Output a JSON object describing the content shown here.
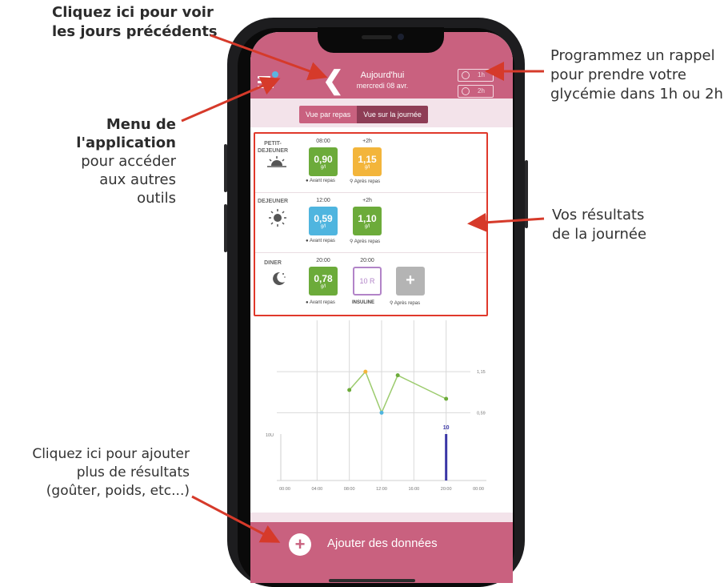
{
  "annotations": {
    "previous_days": [
      "Cliquez ici pour voir",
      "les jours précédents"
    ],
    "menu_bold": [
      "Menu de",
      "l'application"
    ],
    "menu_rest": [
      "pour accéder",
      "aux autres",
      "outils"
    ],
    "reminder": [
      "Programmez un rappel",
      "pour prendre votre",
      "glycémie dans 1h ou 2h"
    ],
    "results": [
      "Vos résultats",
      "de la journée"
    ],
    "add_more": [
      "Cliquez ici pour ajouter",
      "plus de résultats",
      "(goûter, poids, etc...)"
    ]
  },
  "header": {
    "title": "Aujourd'hui",
    "date": "mercredi 08 avr.",
    "back_symbol": "❮",
    "alarm_1h": "1h",
    "alarm_2h": "2h"
  },
  "tabs": {
    "by_meal": "Vue par repas",
    "by_day": "Vue sur la journée"
  },
  "meals": {
    "breakfast": {
      "name_1": "PETIT-",
      "name_2": "DEJEUNER",
      "icon": "sunrise-icon",
      "before_time": "08:00",
      "before_value": "0,90",
      "before_unit": "g/l",
      "before_caption": "Avant repas",
      "after_time": "+2h",
      "after_value": "1,15",
      "after_unit": "g/l",
      "after_caption": "Après repas"
    },
    "lunch": {
      "name_1": "DEJEUNER",
      "icon": "sun-icon",
      "before_time": "12:00",
      "before_value": "0,59",
      "before_unit": "g/l",
      "before_caption": "Avant repas",
      "after_time": "+2h",
      "after_value": "1,10",
      "after_unit": "g/l",
      "after_caption": "Après repas"
    },
    "dinner": {
      "name_1": "DINER",
      "icon": "moon-icon",
      "before_time": "20:00",
      "before_value": "0,78",
      "before_unit": "g/l",
      "before_caption": "Avant repas",
      "insulin_time": "20:00",
      "insulin_value": "10 R",
      "insulin_caption": "INSULINE",
      "after_caption": "Après repas"
    }
  },
  "chart_data": {
    "type": "line",
    "x_ticks": [
      "00:00",
      "04:00",
      "08:00",
      "12:00",
      "16:00",
      "20:00",
      "00:00"
    ],
    "x_range_hours": [
      0,
      24
    ],
    "glucose_range": [
      0.3,
      1.5
    ],
    "glucose_ref_labels": [
      "1,15",
      "0,59"
    ],
    "glucose_ref_values": [
      1.15,
      0.59
    ],
    "glucose_points": [
      {
        "x": 8,
        "y": 0.9,
        "color": "#6cab3a"
      },
      {
        "x": 10,
        "y": 1.15,
        "color": "#f3b53b"
      },
      {
        "x": 12,
        "y": 0.59,
        "color": "#4fb5df"
      },
      {
        "x": 14,
        "y": 1.1,
        "color": "#6cab3a"
      },
      {
        "x": 20,
        "y": 0.78,
        "color": "#6cab3a"
      }
    ],
    "line_color": "#9ccb6e",
    "insulin_axis_label": "10U",
    "insulin_axis_value": 10,
    "insulin_bars": [
      {
        "x": 20,
        "value": 10,
        "label": "10"
      }
    ],
    "insulin_color": "#3a36a6",
    "grid": true
  },
  "footer": {
    "add_label": "Ajouter des données",
    "add_symbol": "+"
  },
  "colors": {
    "primary": "#c9617f",
    "dark_tab": "#8e3d56",
    "highlight": "#e0392b",
    "background_tint": "#f3e3ea"
  }
}
